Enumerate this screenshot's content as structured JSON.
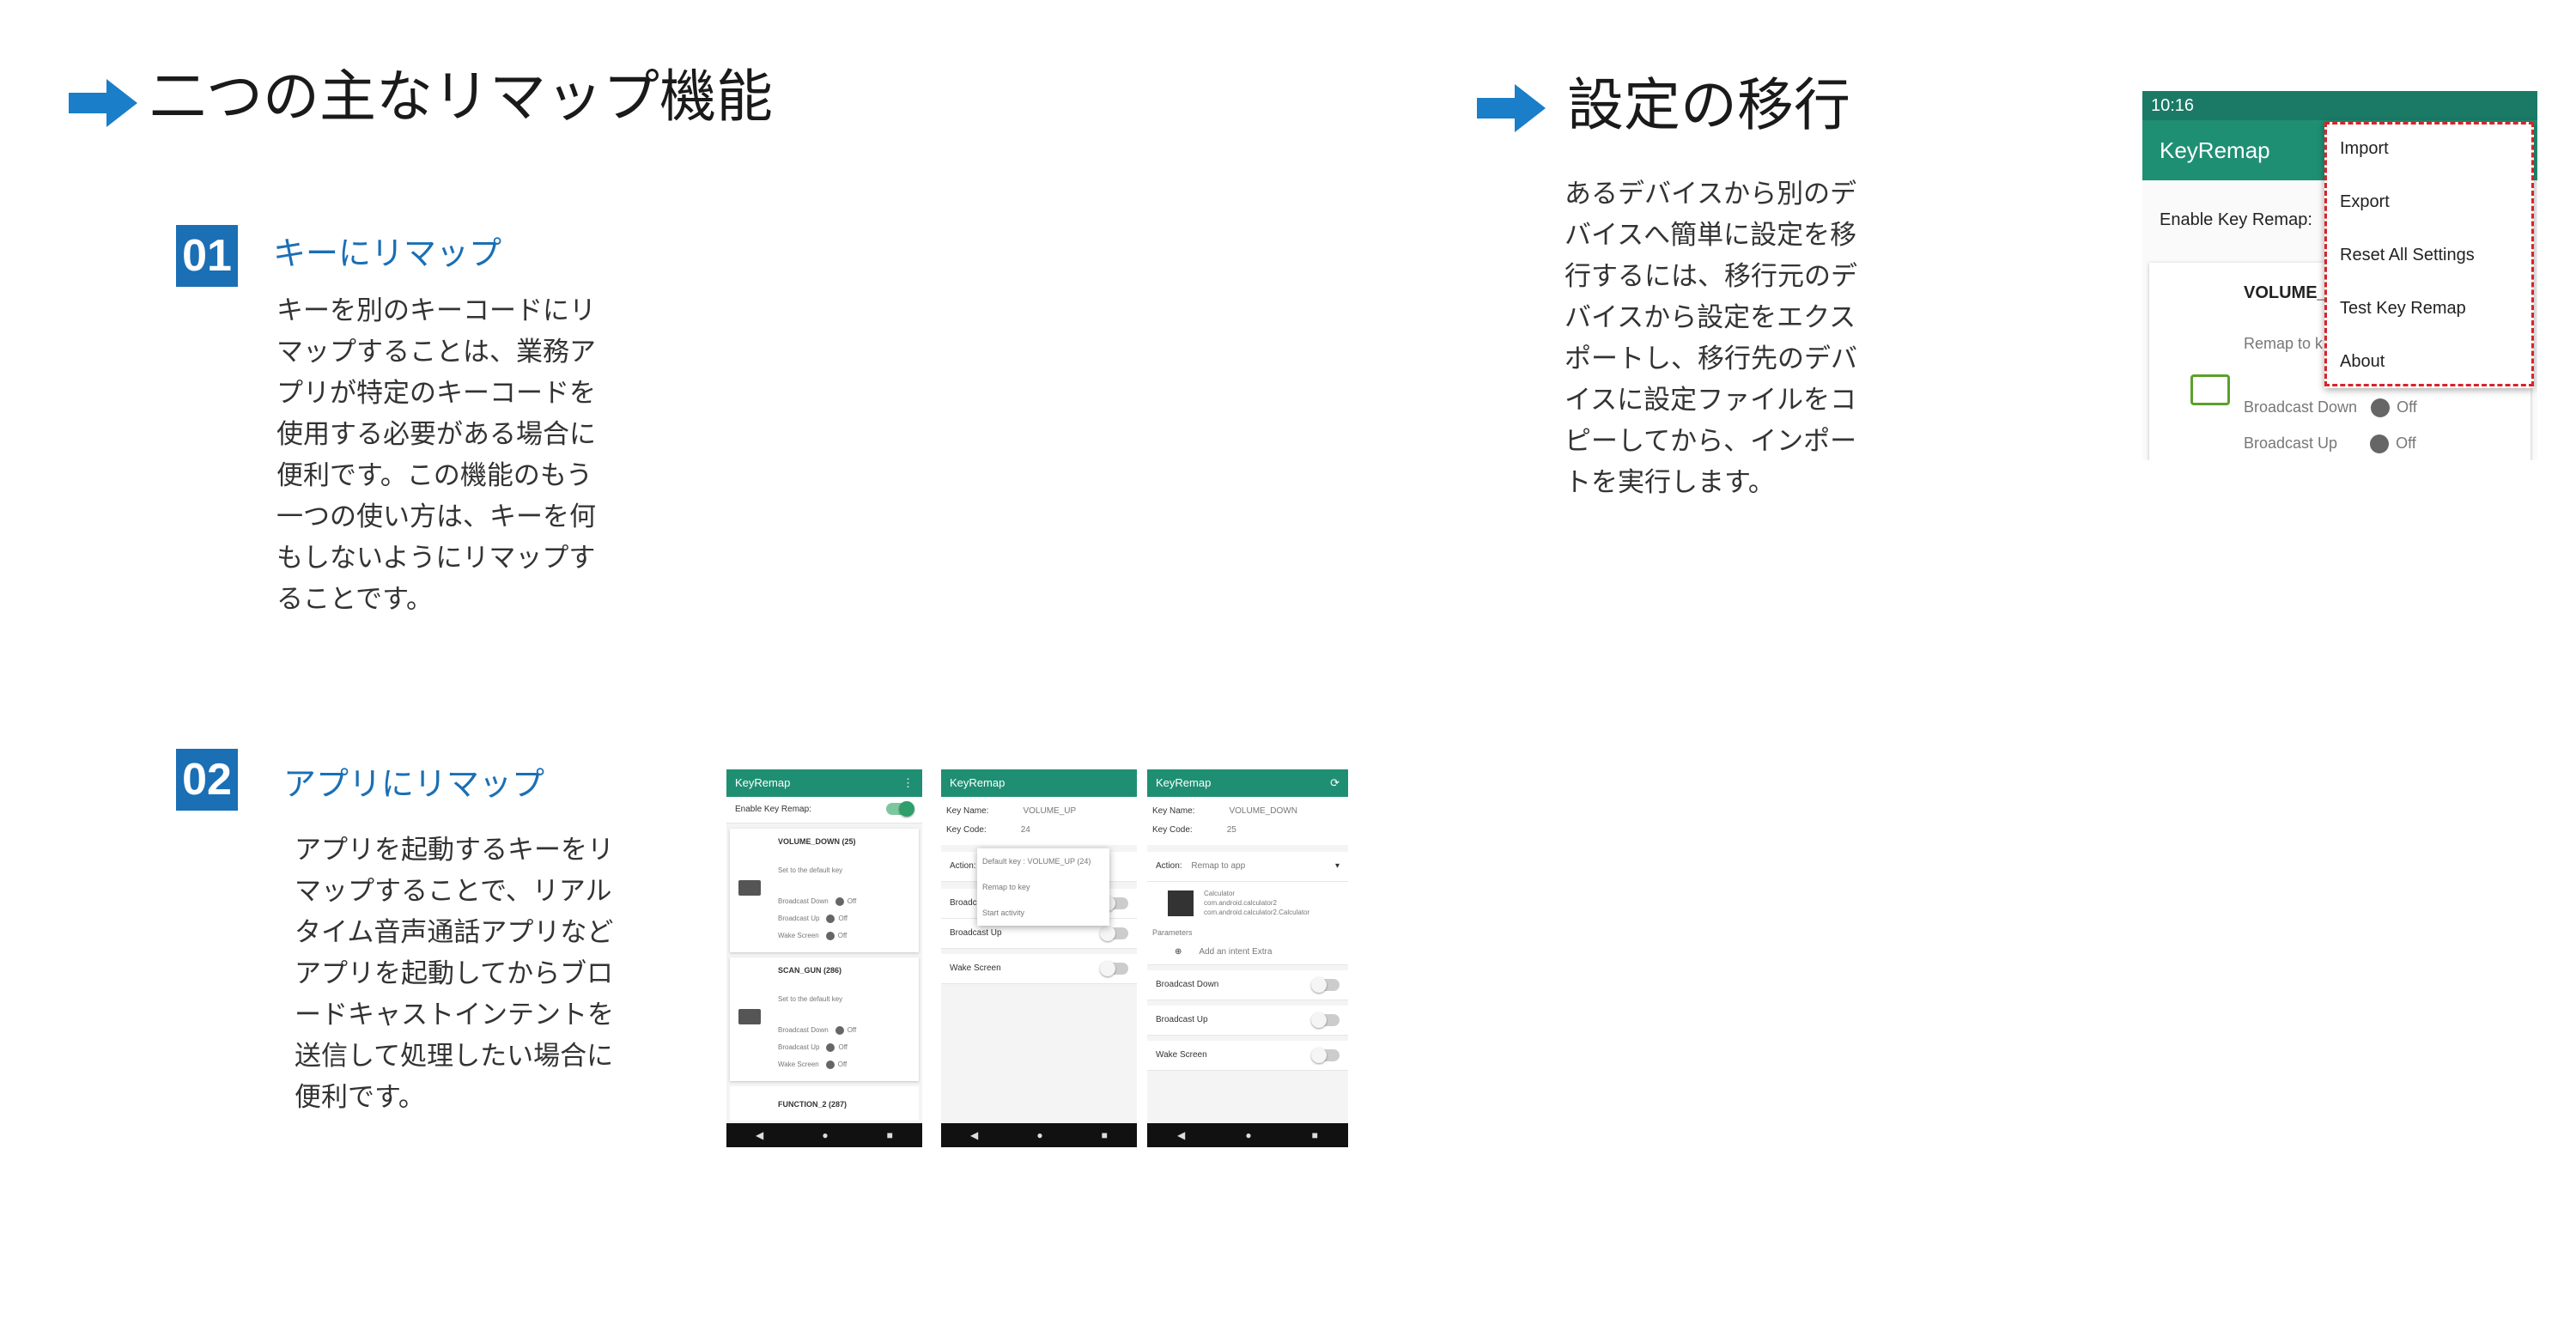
{
  "left": {
    "title": "二つの主なリマップ機能",
    "sections": [
      {
        "number": "01",
        "heading": "キーにリマップ",
        "body": "キーを別のキーコードにリ\nマップすることは、業務ア\nプリが特定のキーコードを\n使用する必要がある場合に\n便利です。この機能のもう\n一つの使い方は、キーを何\nもしないようにリマップす\nることです。"
      },
      {
        "number": "02",
        "heading": "アプリにリマップ",
        "body": "アプリを起動するキーをリ\nマップすることで、リアル\nタイム音声通話アプリなど\nアプリを起動してからブロ\nードキャストインテントを\n送信して処理したい場合に\n便利です。"
      }
    ]
  },
  "right": {
    "title": "設定の移行",
    "body": "あるデバイスから別のデ\nバイスへ簡単に設定を移\n行するには、移行元のデ\nバイスから設定をエクス\nポートし、移行先のデバ\nイスに設定ファイルをコ\nピーしてから、インポー\nトを実行します。"
  },
  "screen1": {
    "app": "KeyRemap",
    "enable_label": "Enable Key Remap:",
    "cards": [
      {
        "title": "VOLUME_DOWN (25)",
        "sub": "Set to the default key",
        "bd": "Broadcast Down",
        "bu": "Broadcast Up",
        "ws": "Wake Screen",
        "off": "Off"
      },
      {
        "title": "SCAN_GUN (286)",
        "sub": "Set to the default key",
        "bd": "Broadcast Down",
        "bu": "Broadcast Up",
        "ws": "Wake Screen",
        "off": "Off"
      }
    ],
    "last": "FUNCTION_2 (287)"
  },
  "screen2": {
    "app": "KeyRemap",
    "key_name_label": "Key Name:",
    "key_name": "VOLUME_UP",
    "key_code_label": "Key Code:",
    "key_code": "24",
    "action_label": "Action:",
    "dropdown": [
      "Default key : VOLUME_UP (24)",
      "Remap to key",
      "Start activity"
    ],
    "broadcast_down": "Broadcast",
    "broadcast_up": "Broadcast Up",
    "wake": "Wake Screen"
  },
  "screen3": {
    "app": "KeyRemap",
    "key_name_label": "Key Name:",
    "key_name": "VOLUME_DOWN",
    "key_code_label": "Key Code:",
    "key_code": "25",
    "action_label": "Action:",
    "action": "Remap to app",
    "app_name": "Calculator",
    "pkg1": "com.android.calculator2",
    "pkg2": "com.android.calculator2.Calculator",
    "params": "Parameters",
    "add_extra": "Add an intent Extra",
    "bd": "Broadcast Down",
    "bu": "Broadcast Up",
    "ws": "Wake Screen"
  },
  "screen4": {
    "time": "10:16",
    "app": "KeyRemap",
    "enable_label": "Enable Key Remap:",
    "card_title": "VOLUME_",
    "remap": "Remap to k",
    "bd": "Broadcast Down",
    "bu": "Broadcast Up",
    "off": "Off",
    "menu": [
      "Import",
      "Export",
      "Reset All Settings",
      "Test Key Remap",
      "About"
    ]
  },
  "colors": {
    "accent": "#1a6fb5",
    "appbar": "#1f8f73",
    "highlight": "#d8232a"
  }
}
